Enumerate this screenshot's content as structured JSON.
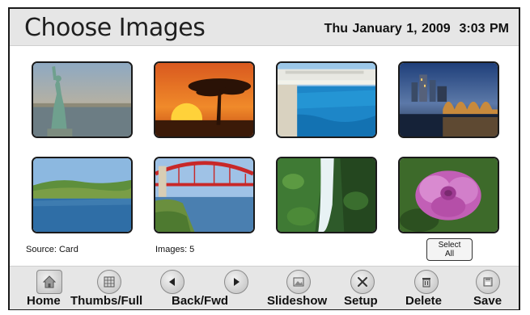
{
  "header": {
    "title": "Choose Images",
    "datetime": "Thu January 1, 2009  3:03 PM"
  },
  "thumbnails": [
    {
      "subject": "Statue of Liberty"
    },
    {
      "subject": "African savanna sunset with acacia tree"
    },
    {
      "subject": "Infinity pool by the sea"
    },
    {
      "subject": "City skyline with arched bridge at night"
    },
    {
      "subject": "Lake shore with trees"
    },
    {
      "subject": "Red arch bridge over river"
    },
    {
      "subject": "Waterfall in green forest"
    },
    {
      "subject": "Pink flower"
    }
  ],
  "info": {
    "source": "Source: Card",
    "images": "Images: 5",
    "select_all_line1": "Select",
    "select_all_line2": "All"
  },
  "toolbar": {
    "home": "Home",
    "thumbs_full": "Thumbs/Full",
    "back_fwd": "Back/Fwd",
    "slideshow": "Slideshow",
    "setup": "Setup",
    "delete": "Delete",
    "save": "Save"
  },
  "icons": {
    "home": "home-icon",
    "thumbs": "thumbnails-icon",
    "back": "back-arrow-icon",
    "forward": "forward-arrow-icon",
    "slideshow": "slideshow-icon",
    "setup": "tools-icon",
    "delete": "trash-icon",
    "save": "floppy-disk-icon"
  }
}
